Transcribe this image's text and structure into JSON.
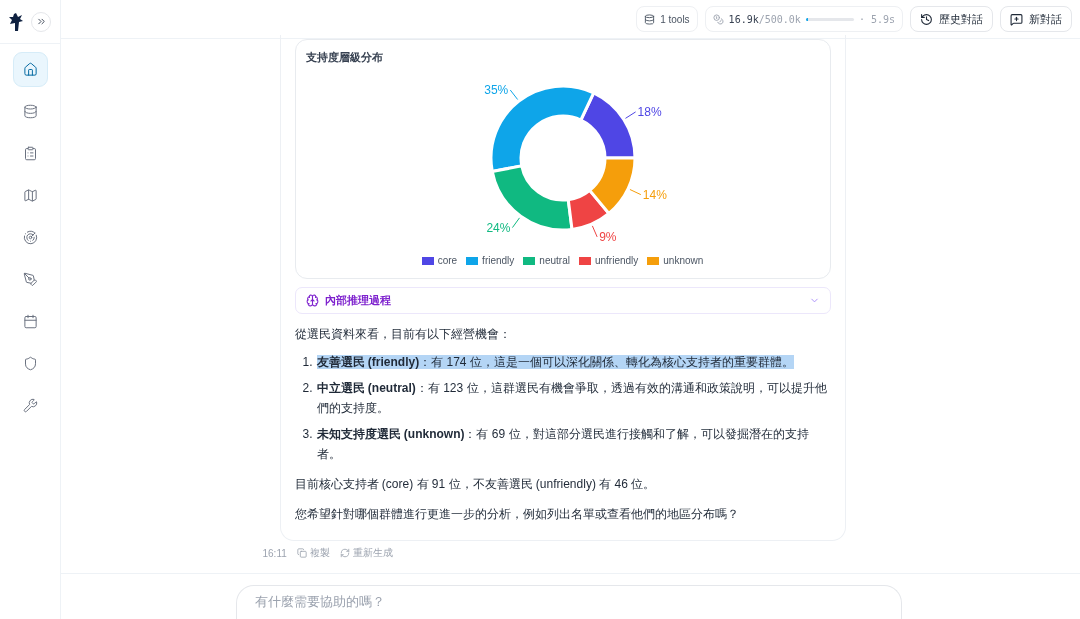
{
  "sidebar": {
    "items": [
      {
        "selected": true
      },
      {
        "selected": false
      },
      {
        "selected": false
      },
      {
        "selected": false
      },
      {
        "selected": false
      },
      {
        "selected": false
      },
      {
        "selected": false
      },
      {
        "selected": false
      },
      {
        "selected": false
      }
    ]
  },
  "header": {
    "tools": "1 tools",
    "tokens_used": "16.9k",
    "tokens_total": "/500.0k",
    "token_usage": {
      "level": 0.034
    },
    "elapsed": "· 5.9s",
    "history_button": "歷史對話",
    "new_button": "新對話"
  },
  "message": {
    "chart": {
      "title": "支持度層級分布",
      "chart_data": {
        "type": "donut",
        "categories": [
          "core",
          "friendly",
          "neutral",
          "unfriendly",
          "unknown"
        ],
        "series": [
          {
            "values": [
              18,
              35,
              24,
              9,
              14
            ]
          }
        ],
        "colors": [
          "#4f46e5",
          "#0ea5e9",
          "#10b981",
          "#ef4444",
          "#f59e0b"
        ],
        "value_labels": [
          "18%",
          "35%",
          "24%",
          "9%",
          "14%"
        ]
      }
    },
    "reasoning": {
      "label": "內部推理過程",
      "expanded": false
    },
    "intro": "從選民資料來看，目前有以下經營機會：",
    "items": [
      {
        "number": "1.",
        "text": "**友善選民 (friendly)**：有 174 位，這是一個可以深化關係、轉化為核心支持者的重要群體。",
        "highlighted": true
      },
      {
        "number": "2.",
        "text": "**中立選民 (neutral)**：有 123 位，這群選民有機會爭取，透過有效的溝通和政策說明，可以提升他們的支持度。",
        "highlighted": false
      },
      {
        "number": "3.",
        "text": "**未知支持度選民 (unknown)**：有 69 位，對這部分選民進行接觸和了解，可以發掘潛在的支持者。",
        "highlighted": false
      }
    ],
    "summary": "目前核心支持者 (core) 有 91 位，不友善選民 (unfriendly) 有 46 位。",
    "question": "您希望針對哪個群體進行更進一步的分析，例如列出名單或查看他們的地區分布嗎？",
    "time": "16:11",
    "copy": "複製",
    "regenerate": "重新生成"
  },
  "composer": {
    "placeholder": "有什麼需要協助的嗎？"
  }
}
